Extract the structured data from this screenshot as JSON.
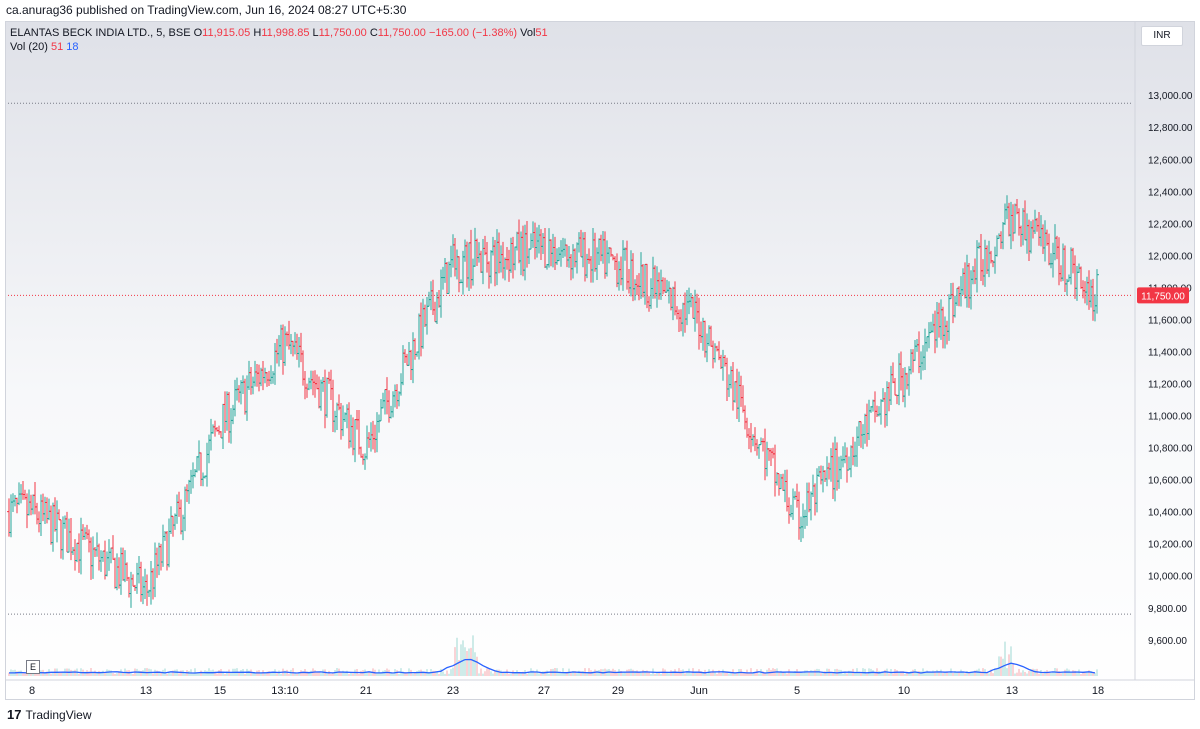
{
  "header": {
    "publish_text": "ca.anurag36 published on TradingView.com, Jun 16, 2024 08:27 UTC+5:30"
  },
  "legend": {
    "symbol": "ELANTAS BECK INDIA LTD., 5, BSE",
    "open_label": "O",
    "open": "11,915.05",
    "high_label": "H",
    "high": "11,998.85",
    "low_label": "L",
    "low": "11,750.00",
    "close_label": "C",
    "close": "11,750.00",
    "change": "−165.00 (−1.38%)",
    "vol_label": "Vol",
    "vol": "51",
    "vol_ma_label": "Vol (20)",
    "vol_ma_1": "51",
    "vol_ma_2": "18"
  },
  "currency_button": "INR",
  "indicator_button": "E",
  "footer": {
    "logo_mark": "17",
    "brand": "TradingView"
  },
  "colors": {
    "up": "#26a69a",
    "down": "#f23645",
    "volume_ma": "#2962ff",
    "price_line": "#f23645"
  },
  "chart_data": {
    "type": "line",
    "title": "ELANTAS BECK INDIA LTD., 5, BSE",
    "y_ticks": [
      "13,000.00",
      "12,800.00",
      "12,600.00",
      "12,400.00",
      "12,200.00",
      "12,000.00",
      "11,800.00",
      "11,600.00",
      "11,400.00",
      "11,200.00",
      "11,000.00",
      "10,800.00",
      "10,600.00",
      "10,400.00",
      "10,200.00",
      "10,000.00",
      "9,800.00",
      "9,600.00"
    ],
    "y_tick_values": [
      13000,
      12800,
      12600,
      12400,
      12200,
      12000,
      11800,
      11600,
      11400,
      11200,
      11000,
      10800,
      10600,
      10400,
      10200,
      10000,
      9800,
      9600
    ],
    "x_ticks": [
      "8",
      "13",
      "15",
      "13:10",
      "21",
      "23",
      "27",
      "29",
      "Jun",
      "5",
      "10",
      "13",
      "18"
    ],
    "ylim": [
      9530,
      13095
    ],
    "last_price": 11750,
    "last_price_label": "11,750.00",
    "high_line": 12950,
    "low_line": 9760,
    "grid": false,
    "series": [
      {
        "x": [
          "8",
          "13",
          "15",
          "13:10",
          "21",
          "23",
          "27",
          "29",
          "Jun",
          "5",
          "10",
          "13",
          "18"
        ],
        "values": [
          10400,
          9900,
          10950,
          11450,
          10800,
          11950,
          12050,
          11950,
          11600,
          10350,
          11250,
          12250,
          11750
        ]
      }
    ]
  }
}
